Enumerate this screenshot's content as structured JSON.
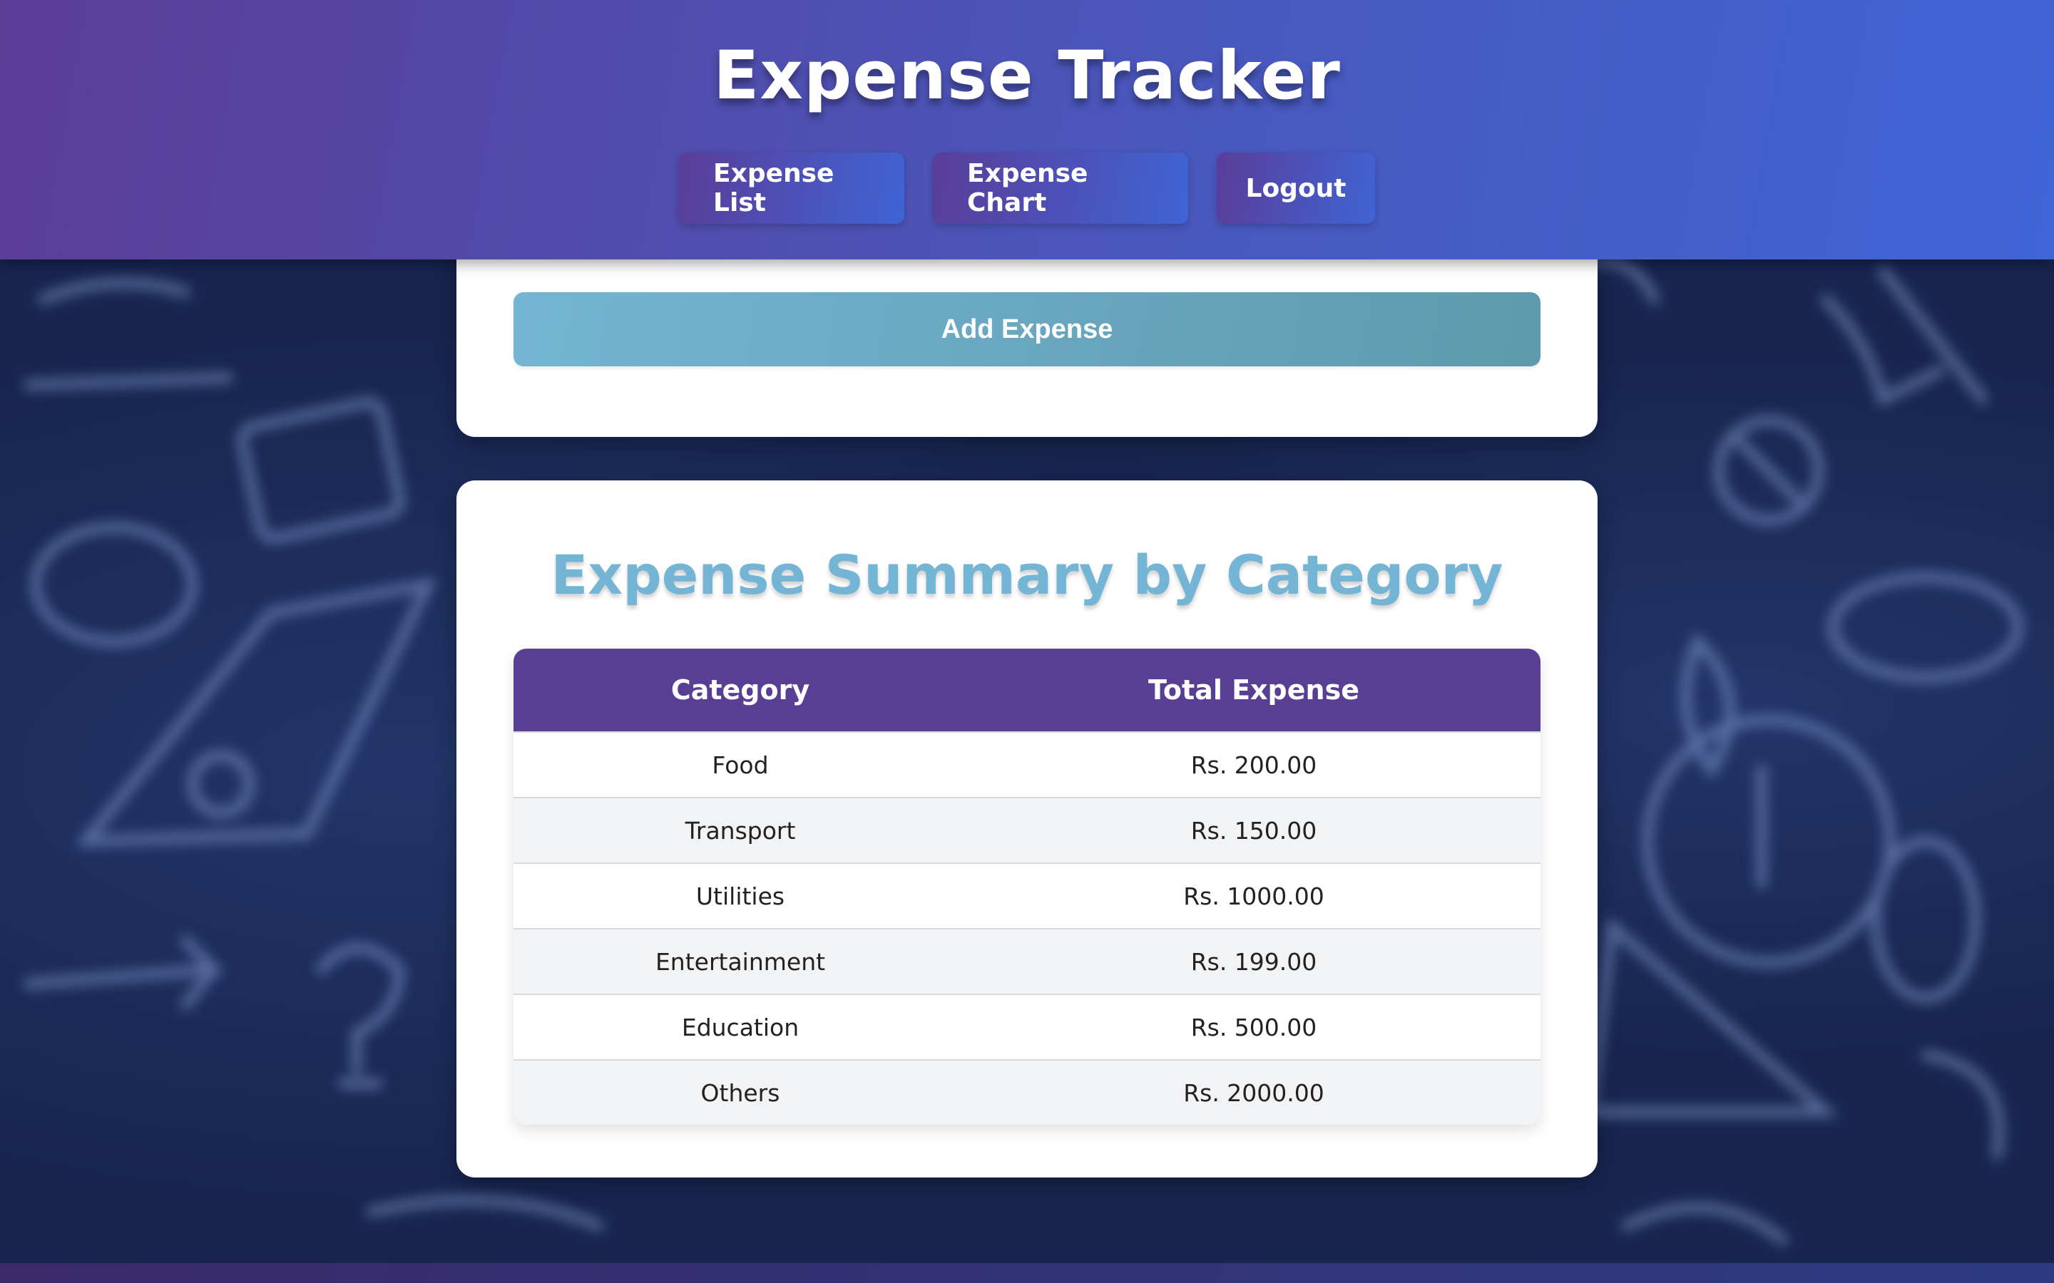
{
  "header": {
    "title": "Expense Tracker",
    "nav": [
      {
        "label": "Expense List"
      },
      {
        "label": "Expense Chart"
      },
      {
        "label": "Logout"
      }
    ]
  },
  "add_form": {
    "submit_label": "Add Expense"
  },
  "summary": {
    "title": "Expense Summary by Category",
    "columns": [
      "Category",
      "Total Expense"
    ],
    "rows": [
      {
        "category": "Food",
        "total": "Rs. 200.00"
      },
      {
        "category": "Transport",
        "total": "Rs. 150.00"
      },
      {
        "category": "Utilities",
        "total": "Rs. 1000.00"
      },
      {
        "category": "Entertainment",
        "total": "Rs. 199.00"
      },
      {
        "category": "Education",
        "total": "Rs. 500.00"
      },
      {
        "category": "Others",
        "total": "Rs. 2000.00"
      }
    ]
  },
  "colors": {
    "header_gradient_start": "#5b3d98",
    "header_gradient_end": "#3f65d6",
    "table_header": "#583f94",
    "summary_title": "#74b5d6",
    "add_button": "#6aa8c2",
    "background": "#17254f"
  }
}
